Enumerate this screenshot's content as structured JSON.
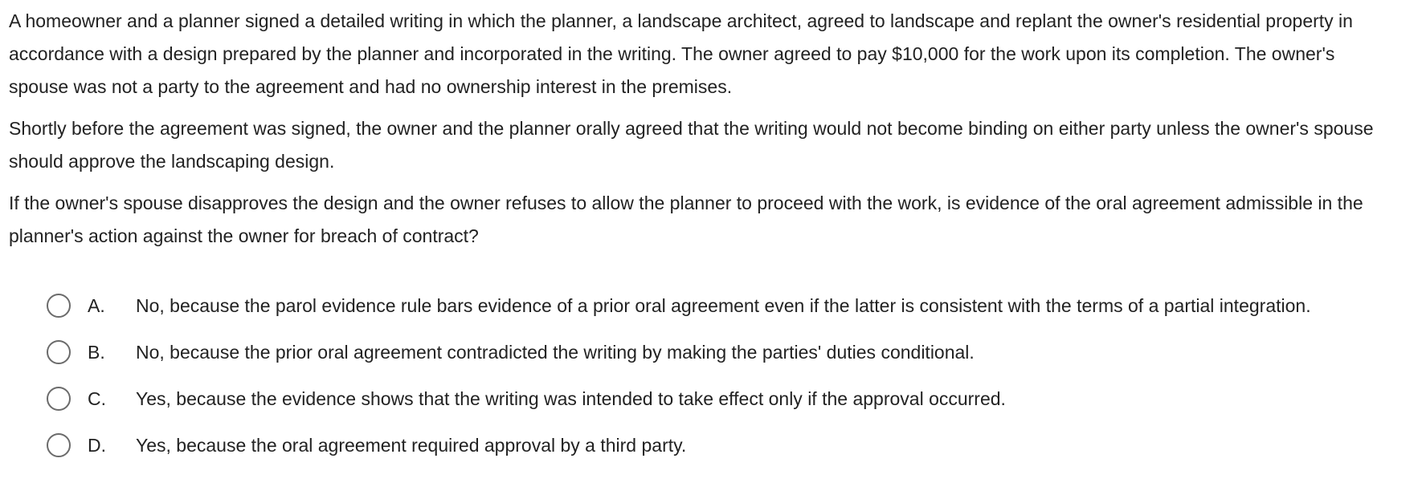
{
  "question": {
    "stem": [
      "A homeowner and a planner signed a detailed writing in which the planner, a landscape architect, agreed to landscape and replant the owner's residential property in accordance with a design prepared by the planner and incorporated in the writing.  The owner agreed to pay $10,000 for the work upon its completion.  The owner's spouse was not a party to the agreement and had no ownership interest in the premises.",
      "Shortly before the agreement was signed, the owner and the planner orally agreed that the writing would not become binding on either party unless the owner's spouse should approve the landscaping design.",
      "If the owner's spouse disapproves the design and the owner refuses to allow the planner to proceed with the work, is evidence of the oral agreement admissible in the planner's action against the owner for breach of contract?"
    ],
    "choices": [
      {
        "letter": "A.",
        "text": "No, because the parol evidence rule bars evidence of a prior oral agreement even if the latter is consistent with the terms of a partial integration."
      },
      {
        "letter": "B.",
        "text": "No, because the prior oral agreement contradicted the writing by making the parties' duties conditional."
      },
      {
        "letter": "C.",
        "text": "Yes, because the evidence shows that the writing was intended to take effect only if the approval occurred."
      },
      {
        "letter": "D.",
        "text": "Yes, because the oral agreement required approval by a third party."
      }
    ]
  }
}
